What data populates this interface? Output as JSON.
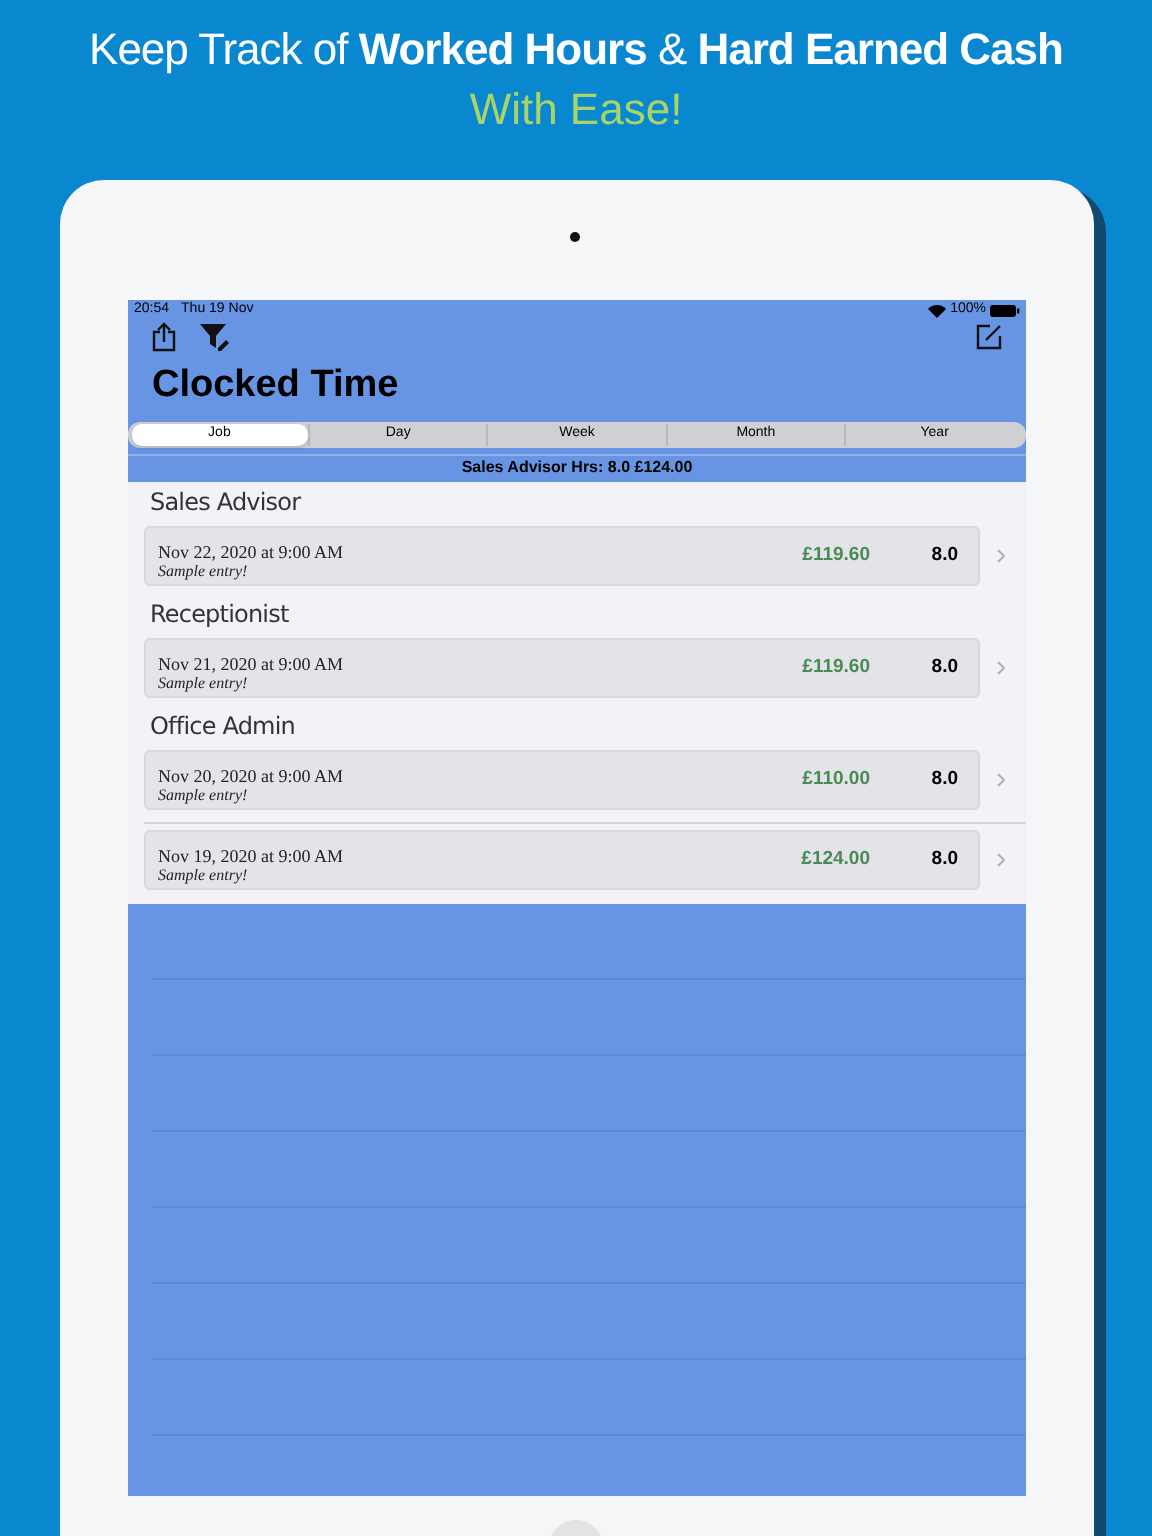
{
  "headline": {
    "line_1": "Keep Track of **Worked Hours** &  **Hard Earned Cash**",
    "line_2": "With Ease!"
  },
  "status_bar": {
    "time": "20:54",
    "date": "Thu 19 Nov",
    "battery": "100%"
  },
  "title": "Clocked Time",
  "tabs": [
    {
      "label": "Job",
      "selected": true
    },
    {
      "label": "Day",
      "selected": false
    },
    {
      "label": "Week",
      "selected": false
    },
    {
      "label": "Month",
      "selected": false
    },
    {
      "label": "Year",
      "selected": false
    }
  ],
  "summary": "Sales Advisor  Hrs: 8.0  £124.00",
  "sections": [
    {
      "header": "Sales Advisor",
      "entries": [
        {
          "date": "Nov 22, 2020 at 9:00 AM",
          "note": "Sample entry!",
          "amount": "£119.60",
          "hours": "8.0"
        }
      ]
    },
    {
      "header": "Receptionist",
      "entries": [
        {
          "date": "Nov 21, 2020 at 9:00 AM",
          "note": "Sample entry!",
          "amount": "£119.60",
          "hours": "8.0"
        }
      ]
    },
    {
      "header": "Office Admin",
      "entries": [
        {
          "date": "Nov 20, 2020 at 9:00 AM",
          "note": "Sample entry!",
          "amount": "£110.00",
          "hours": "8.0"
        },
        {
          "date": "Nov 19, 2020 at 9:00 AM",
          "note": "Sample entry!",
          "amount": "£124.00",
          "hours": "8.0"
        }
      ]
    }
  ]
}
